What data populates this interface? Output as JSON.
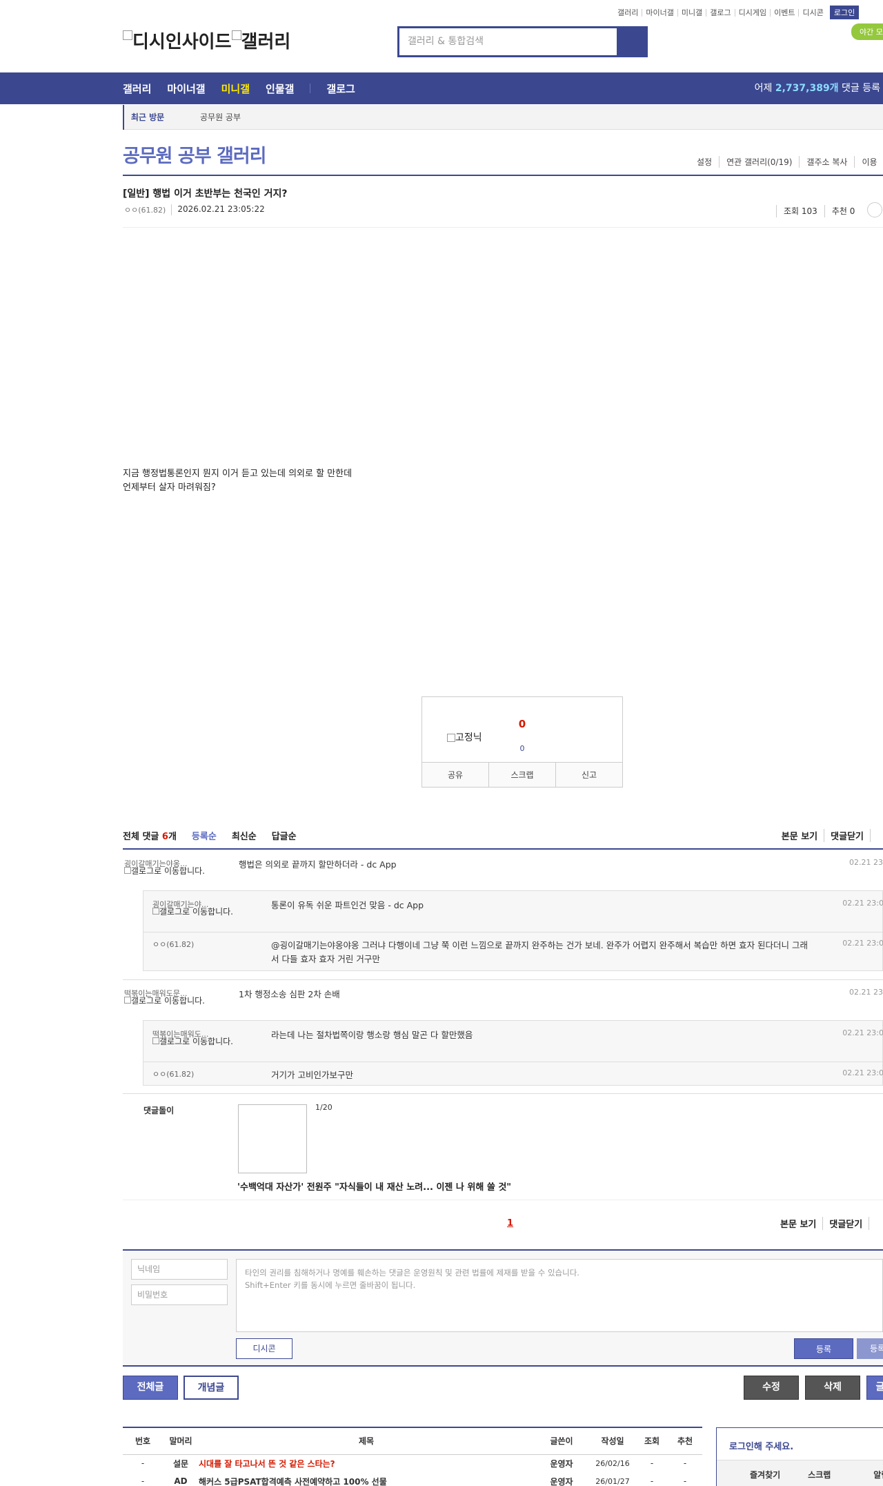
{
  "top_links": [
    "갤러리",
    "마이너갤",
    "미니갤",
    "갤로그",
    "디시게임",
    "이벤트",
    "디시콘"
  ],
  "login_label": "로그인",
  "night_label": "야간 모",
  "logo_text": "디시인사이드",
  "logo_gallery": "갤러리",
  "search": {
    "placeholder": "갤러리 & 통합검색"
  },
  "gnb": {
    "items": [
      "갤러리",
      "마이너갤",
      "미니갤",
      "인물갤",
      "갤로그"
    ],
    "stat_prefix": "어제 ",
    "stat_count": "2,737,389개",
    "stat_suffix": " 댓글 등록"
  },
  "visit": {
    "label": "최근 방문",
    "item": "공무원 공부"
  },
  "gallery": {
    "title": "공무원 공부 갤러리",
    "tools": [
      "설정",
      "연관 갤러리(0/19)",
      "갤주소 복사",
      "이용"
    ]
  },
  "post": {
    "title": "[일반] 행법 이거 초반부는 천국인 거지?",
    "writer": "ㅇㅇ",
    "ip": "(61.82)",
    "date": "2026.02.21 23:05:22",
    "views": "조회 103",
    "reco": "추천 0",
    "body_line1": "지금 행정법통론인지 뭔지 이거 듣고 있는데 의외로 할 만한데",
    "body_line2": "언제부터 살자 마려워짐?"
  },
  "recommend": {
    "count": "0",
    "image_alt": "고정닉",
    "fix_count": "0",
    "buttons": [
      "공유",
      "스크랩",
      "신고"
    ]
  },
  "comments_header": {
    "all_label": "전체 댓글 ",
    "count": "6",
    "unit": "개",
    "sort_tabs": [
      "등록순",
      "최신순",
      "답글순"
    ],
    "right": [
      "본문 보기",
      "댓글닫기",
      ""
    ]
  },
  "gallog_alt": "갤로그로 이동합니다.",
  "comments": [
    {
      "nick": "굉이갈매기는야옹...",
      "text": "행법은 의외로 끝까지 할만하더라 - dc App",
      "time": "02.21 23"
    },
    {
      "nick": "떡볶이는매워도문...",
      "text": "1차 행정소송 심판 2차 손배",
      "time": "02.21 23"
    }
  ],
  "replies": [
    {
      "nick": "굉이갈매기는야...",
      "text": "통론이 유독 쉬운 파트인건 맞음 - dc App",
      "time": "02.21 23:0"
    },
    {
      "nick": "ㅇㅇ(61.82)",
      "mention": "@굉이갈매기는야옹야옹",
      "text": " 그러냐 다행이네 그냥 쭉 이런 느낌으로 끝까지 완주하는 건가 보네. 완주가 어렵지 완주해서 복습만 하면 효자 된다더니 그래서 다들 효자 효자 거린 거구만",
      "time": "02.21 23:0"
    },
    {
      "nick": "떡볶이는매워도...",
      "text": "라는데 나는 절차법쪽이랑 행소랑 행심 말곤 다 할만했음",
      "time": "02.21 23:0"
    },
    {
      "nick": "ㅇㅇ(61.82)",
      "text": "거기가 고비인가보구만",
      "time": "02.21 23:0"
    }
  ],
  "bot": {
    "label": "댓글돌이",
    "page": "1/20",
    "headline": "'수백억대 자산가' 전원주 \"자식들이 내 재산 노려... 이젠 나 위해 쓸 것\""
  },
  "pager": {
    "current": "1",
    "right": [
      "본문 보기",
      "댓글닫기",
      ""
    ]
  },
  "write": {
    "nick_placeholder": "닉네임",
    "pw_placeholder": "비밀번호",
    "notice1": "타인의 권리를 침해하거나 명예를 훼손하는 댓글은 운영원칙 및 관련 법률에 제재를 받을 수 있습니다.",
    "notice2": "Shift+Enter 키를 동시에 누르면 줄바꿈이 됩니다.",
    "dccon": "디시콘",
    "submit": "등록",
    "submit2": "등록"
  },
  "buttons": {
    "all": "전체글",
    "best": "개념글",
    "edit": "수정",
    "delete": "삭제",
    "write": "글"
  },
  "list": {
    "headers": [
      "번호",
      "말머리",
      "제목",
      "글쓴이",
      "작성일",
      "조회",
      "추천"
    ],
    "rows": [
      [
        "-",
        "설문",
        "시대를 잘 타고나서 뜬 것 같은 스타는?",
        "운영자",
        "26/02/16",
        "-",
        "-"
      ],
      [
        "-",
        "AD",
        "해커스 5급PSAT합격예측 사전예약하고 100% 선물",
        "운영자",
        "26/01/27",
        "-",
        "-"
      ]
    ]
  },
  "login_box": {
    "title": "로그인해 주세요.",
    "tabs": [
      "즐겨찾기",
      "스크랩",
      "알림"
    ]
  },
  "colors": {
    "brand": "#3b4890",
    "accent": "#5c6bc0",
    "highlight": "#ffea00",
    "alert": "#d31900"
  }
}
